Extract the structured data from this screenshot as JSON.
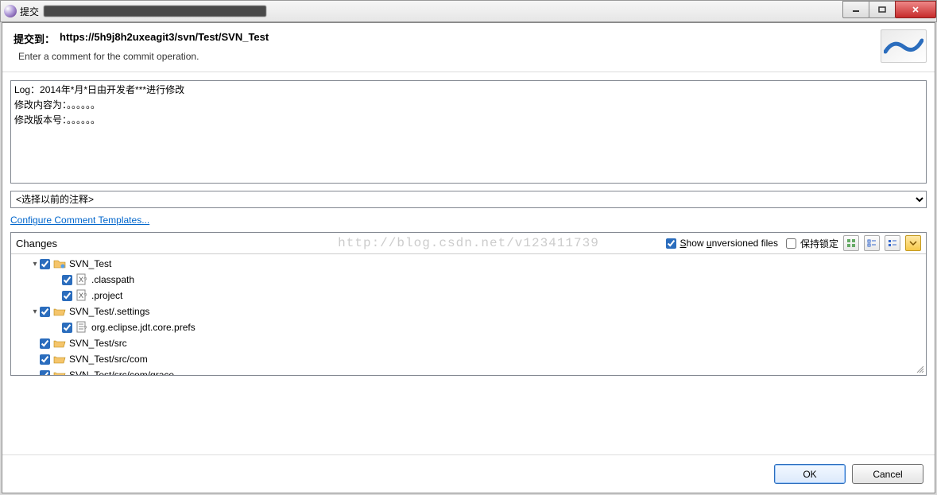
{
  "window": {
    "title": "提交"
  },
  "header": {
    "label": "提交到：",
    "url": "https://5h9j8h2uxeagit3/svn/Test/SVN_Test",
    "hint": "Enter a comment for the commit operation."
  },
  "comment": "Log：2014年*月*日由开发者***进行修改\n修改内容为：。。。。。。\n修改版本号：。。。。。。",
  "prev_comment_placeholder": "<选择以前的注释>",
  "template_link": "Configure Comment Templates...",
  "changes": {
    "title": "Changes",
    "show_unversioned_label": "Show unversioned files",
    "show_unversioned_checked": true,
    "keep_lock_label": "保持锁定",
    "keep_lock_checked": false,
    "items": [
      {
        "level": 1,
        "expander": "▾",
        "checked": true,
        "icon": "folder-share",
        "label": "SVN_Test"
      },
      {
        "level": 2,
        "expander": "",
        "checked": true,
        "icon": "file-q",
        "label": ".classpath"
      },
      {
        "level": 2,
        "expander": "",
        "checked": true,
        "icon": "file-q",
        "label": ".project"
      },
      {
        "level": 1,
        "expander": "▾",
        "checked": true,
        "icon": "folder-open",
        "label": "SVN_Test/.settings"
      },
      {
        "level": 2,
        "expander": "",
        "checked": true,
        "icon": "file-prefs",
        "label": "org.eclipse.jdt.core.prefs"
      },
      {
        "level": 1,
        "expander": "",
        "checked": true,
        "icon": "folder-open",
        "label": "SVN_Test/src"
      },
      {
        "level": 1,
        "expander": "",
        "checked": true,
        "icon": "folder-open",
        "label": "SVN_Test/src/com"
      },
      {
        "level": 1,
        "expander": "",
        "checked": true,
        "icon": "folder-open",
        "label": "SVN_Test/src/com/grace"
      }
    ]
  },
  "watermark": "http://blog.csdn.net/v123411739",
  "buttons": {
    "ok": "OK",
    "cancel": "Cancel"
  }
}
